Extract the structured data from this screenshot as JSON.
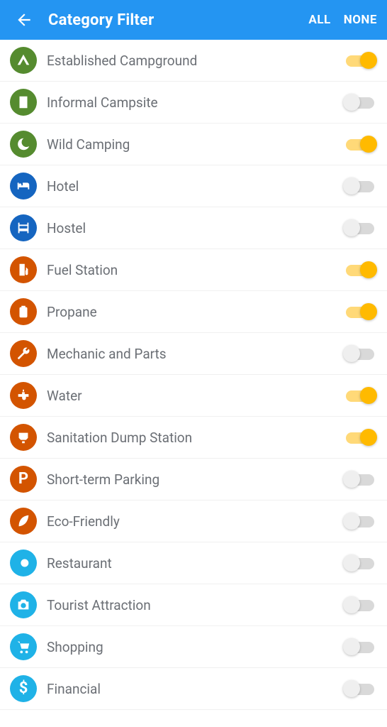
{
  "header": {
    "title": "Category Filter",
    "all_label": "ALL",
    "none_label": "NONE"
  },
  "categories": [
    {
      "id": "established-campground",
      "label": "Established Campground",
      "icon": "tent",
      "color": "c-green",
      "on": true
    },
    {
      "id": "informal-campsite",
      "label": "Informal Campsite",
      "icon": "building",
      "color": "c-green",
      "on": false
    },
    {
      "id": "wild-camping",
      "label": "Wild Camping",
      "icon": "moon",
      "color": "c-green",
      "on": true
    },
    {
      "id": "hotel",
      "label": "Hotel",
      "icon": "bed",
      "color": "c-blue",
      "on": false
    },
    {
      "id": "hostel",
      "label": "Hostel",
      "icon": "bunk",
      "color": "c-blue",
      "on": false
    },
    {
      "id": "fuel-station",
      "label": "Fuel Station",
      "icon": "fuel",
      "color": "c-orange",
      "on": true
    },
    {
      "id": "propane",
      "label": "Propane",
      "icon": "propane",
      "color": "c-orange",
      "on": true
    },
    {
      "id": "mechanic-and-parts",
      "label": "Mechanic and Parts",
      "icon": "wrench",
      "color": "c-orange",
      "on": false
    },
    {
      "id": "water",
      "label": "Water",
      "icon": "faucet",
      "color": "c-orange",
      "on": true
    },
    {
      "id": "sanitation-dump",
      "label": "Sanitation Dump Station",
      "icon": "dump",
      "color": "c-orange",
      "on": true
    },
    {
      "id": "short-term-parking",
      "label": "Short-term Parking",
      "icon": "letter-p",
      "color": "c-orange",
      "on": false
    },
    {
      "id": "eco-friendly",
      "label": "Eco-Friendly",
      "icon": "leaf",
      "color": "c-orange",
      "on": false
    },
    {
      "id": "restaurant",
      "label": "Restaurant",
      "icon": "dining",
      "color": "c-cyan",
      "on": false
    },
    {
      "id": "tourist-attraction",
      "label": "Tourist Attraction",
      "icon": "camera",
      "color": "c-cyan",
      "on": false
    },
    {
      "id": "shopping",
      "label": "Shopping",
      "icon": "cart",
      "color": "c-cyan",
      "on": false
    },
    {
      "id": "financial",
      "label": "Financial",
      "icon": "dollar",
      "color": "c-cyan",
      "on": false
    }
  ]
}
